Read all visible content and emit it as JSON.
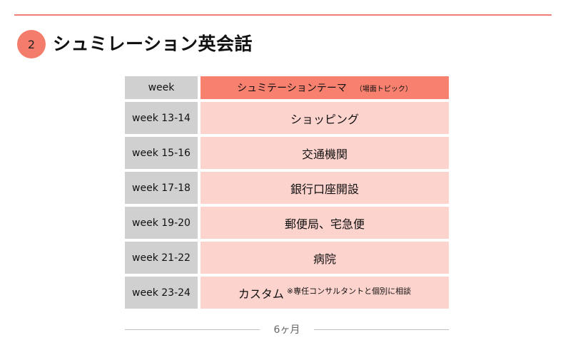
{
  "section": {
    "number": "2",
    "title": "シュミレーション英会話"
  },
  "table": {
    "header": {
      "week": "week",
      "topic": "シュミテーションテーマ",
      "topic_note": "（場面トピック）"
    },
    "rows": [
      {
        "week": "week 13-14",
        "topic": "ショッピング",
        "note": ""
      },
      {
        "week": "week 15-16",
        "topic": "交通機関",
        "note": ""
      },
      {
        "week": "week 17-18",
        "topic": "銀行口座開設",
        "note": ""
      },
      {
        "week": "week 19-20",
        "topic": "郵便局、宅急便",
        "note": ""
      },
      {
        "week": "week 21-22",
        "topic": "病院",
        "note": ""
      },
      {
        "week": "week 23-24",
        "topic": "カスタム",
        "note": "※専任コンサルタントと個別に相談"
      }
    ]
  },
  "footer": {
    "duration": "6ヶ月"
  },
  "colors": {
    "accent": "#f47c6c",
    "rule": "#ef7f78",
    "header_topic_bg": "#f8806f",
    "row_topic_bg": "#fdd3cd",
    "week_bg": "#d0d0d0"
  }
}
